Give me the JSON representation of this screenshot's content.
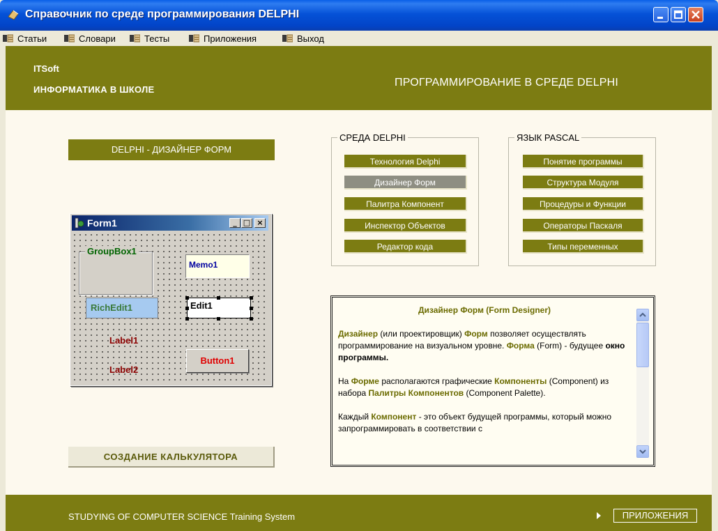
{
  "window": {
    "title": "Справочник по среде программирования DELPHI",
    "controls": [
      "minimize",
      "maximize",
      "close"
    ]
  },
  "menu": [
    {
      "label": "Статьи",
      "icon": "folder-icon"
    },
    {
      "label": "Словари",
      "icon": "folder-icon"
    },
    {
      "label": "Тесты",
      "icon": "folder-icon"
    },
    {
      "label": "Приложения",
      "icon": "folder-icon"
    },
    {
      "label": "Выход",
      "icon": "folder-icon"
    }
  ],
  "header": {
    "brand": "ITSoft",
    "subtitle": "ИНФОРМАТИКА В ШКОЛЕ",
    "right_title": "ПРОГРАММИРОВАНИЕ В СРЕДЕ DELPHI"
  },
  "section_title": "DELPHI - ДИЗАЙНЕР ФОРМ",
  "groups": {
    "delphi": {
      "legend": "СРЕДА DELPHI",
      "items": [
        "Технология Delphi",
        "Дизайнер Форм",
        "Палитра Компонент",
        "Инспектор Объектов",
        "Редактор кода"
      ],
      "active": "Дизайнер Форм"
    },
    "pascal": {
      "legend": "ЯЗЫК PASCAL",
      "items": [
        "Понятие программы",
        "Структура Модуля",
        "Процедуры и Функции",
        "Операторы Паскаля",
        "Типы переменных"
      ]
    }
  },
  "form1": {
    "title": "Form1",
    "groupbox": "GroupBox1",
    "memo": "Memo1",
    "richedit": "RichEdit1",
    "edit": "Edit1",
    "label1": "Label1",
    "label2": "Label2",
    "button": "Button1"
  },
  "calc_button": "СОЗДАНИЕ КАЛЬКУЛЯТОРА",
  "info": {
    "title": "Дизайнер Форм (Form Designer)",
    "p1": {
      "a": "Дизайнер",
      "b": " (или проектировщик) ",
      "c": "Форм",
      "d": " позволяет осуществлять программирование на визуальном уровне. ",
      "e": "Форма",
      "f": " (Form) -  будущее ",
      "g": "окно программы."
    },
    "p2": {
      "a": "На ",
      "b": "Форме",
      "c": " располагаются графические ",
      "d": "Компоненты",
      "e": " (Component) из набора  ",
      "f": "Палитры Компонентов",
      "g": " (Component Palette)."
    },
    "p3": {
      "a": "Каждый ",
      "b": "Компонент",
      "c": " - это объект будущей программы, который можно запрограммировать в соответствии с"
    }
  },
  "footer": {
    "text": "STUDYING OF COMPUTER SCIENCE Training System",
    "button": "ПРИЛОЖЕНИЯ"
  },
  "colors": {
    "olive": "#7C7C12",
    "panel": "#FDF9EE",
    "active_button": "#8E8E82",
    "titlebar": "#0552D8"
  }
}
